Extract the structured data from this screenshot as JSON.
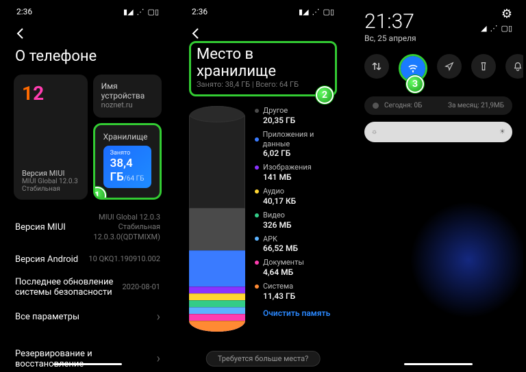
{
  "phone1": {
    "time": "2:36",
    "title": "О телефоне",
    "miui_version_label": "Версия MIUI",
    "miui_version_value": "MIUI Global 12.0.3",
    "miui_channel": "Стабильная",
    "device_name_label": "Имя устройства",
    "device_name_value": "noznet.ru",
    "storage_label": "Хранилище",
    "storage_used_label": "Занято",
    "storage_used": "38,4 ГБ",
    "storage_total": "/64 ГБ",
    "rows": {
      "miui_label": "Версия MIUI",
      "miui_value": "MIUI Global 12.0.3\nСтабильная\n12.0.3.0(QDTMIXM)",
      "android_label": "Версия Android",
      "android_value": "10 QKQ1.190910.002",
      "security_label": "Последнее обновление системы безопасности",
      "security_value": "2020-08-01",
      "all_params": "Все параметры",
      "backup": "Резервирование и восстановление"
    }
  },
  "phone2": {
    "time": "2:36",
    "title": "Место в хранилище",
    "subtitle_used": "Занято: 38,4 ГБ",
    "subtitle_total": "Всего: 64 ГБ",
    "categories": [
      {
        "name": "Другое",
        "value": "20,35 ГБ",
        "color": "#4a4a4a"
      },
      {
        "name": "Приложения и данные",
        "value": "6,02 ГБ",
        "color": "#3a7bff"
      },
      {
        "name": "Изображения",
        "value": "141 МБ",
        "color": "#8a33ff"
      },
      {
        "name": "Аудио",
        "value": "40,17 КБ",
        "color": "#ffd633"
      },
      {
        "name": "Видео",
        "value": "326 МБ",
        "color": "#33cc88"
      },
      {
        "name": "APK",
        "value": "66,52 МБ",
        "color": "#5cb3ff"
      },
      {
        "name": "Документы",
        "value": "4,64 МБ",
        "color": "#ff3db0"
      },
      {
        "name": "Система",
        "value": "11,43 ГБ",
        "color": "#ff8a33"
      }
    ],
    "clear_label": "Очистить память",
    "need_more": "Требуется больше места?"
  },
  "phone3": {
    "time": "21:37",
    "date": "Вс, 25 апреля",
    "status_icons": "",
    "usage_today": "Сегодня: 0Б",
    "usage_month": "За месяц: 21,9МБ"
  },
  "badges": {
    "b1": "1",
    "b2": "2",
    "b3": "3"
  }
}
